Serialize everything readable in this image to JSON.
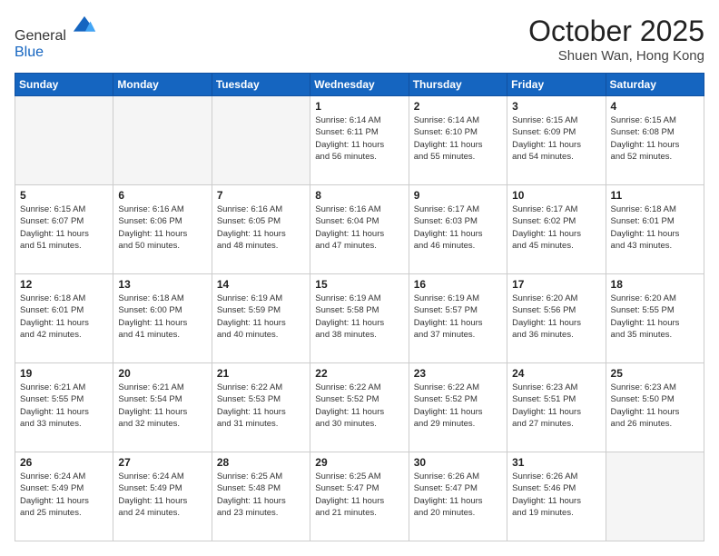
{
  "header": {
    "logo_general": "General",
    "logo_blue": "Blue",
    "month_title": "October 2025",
    "location": "Shuen Wan, Hong Kong"
  },
  "days_of_week": [
    "Sunday",
    "Monday",
    "Tuesday",
    "Wednesday",
    "Thursday",
    "Friday",
    "Saturday"
  ],
  "weeks": [
    [
      {
        "day": "",
        "info": ""
      },
      {
        "day": "",
        "info": ""
      },
      {
        "day": "",
        "info": ""
      },
      {
        "day": "1",
        "info": "Sunrise: 6:14 AM\nSunset: 6:11 PM\nDaylight: 11 hours\nand 56 minutes."
      },
      {
        "day": "2",
        "info": "Sunrise: 6:14 AM\nSunset: 6:10 PM\nDaylight: 11 hours\nand 55 minutes."
      },
      {
        "day": "3",
        "info": "Sunrise: 6:15 AM\nSunset: 6:09 PM\nDaylight: 11 hours\nand 54 minutes."
      },
      {
        "day": "4",
        "info": "Sunrise: 6:15 AM\nSunset: 6:08 PM\nDaylight: 11 hours\nand 52 minutes."
      }
    ],
    [
      {
        "day": "5",
        "info": "Sunrise: 6:15 AM\nSunset: 6:07 PM\nDaylight: 11 hours\nand 51 minutes."
      },
      {
        "day": "6",
        "info": "Sunrise: 6:16 AM\nSunset: 6:06 PM\nDaylight: 11 hours\nand 50 minutes."
      },
      {
        "day": "7",
        "info": "Sunrise: 6:16 AM\nSunset: 6:05 PM\nDaylight: 11 hours\nand 48 minutes."
      },
      {
        "day": "8",
        "info": "Sunrise: 6:16 AM\nSunset: 6:04 PM\nDaylight: 11 hours\nand 47 minutes."
      },
      {
        "day": "9",
        "info": "Sunrise: 6:17 AM\nSunset: 6:03 PM\nDaylight: 11 hours\nand 46 minutes."
      },
      {
        "day": "10",
        "info": "Sunrise: 6:17 AM\nSunset: 6:02 PM\nDaylight: 11 hours\nand 45 minutes."
      },
      {
        "day": "11",
        "info": "Sunrise: 6:18 AM\nSunset: 6:01 PM\nDaylight: 11 hours\nand 43 minutes."
      }
    ],
    [
      {
        "day": "12",
        "info": "Sunrise: 6:18 AM\nSunset: 6:01 PM\nDaylight: 11 hours\nand 42 minutes."
      },
      {
        "day": "13",
        "info": "Sunrise: 6:18 AM\nSunset: 6:00 PM\nDaylight: 11 hours\nand 41 minutes."
      },
      {
        "day": "14",
        "info": "Sunrise: 6:19 AM\nSunset: 5:59 PM\nDaylight: 11 hours\nand 40 minutes."
      },
      {
        "day": "15",
        "info": "Sunrise: 6:19 AM\nSunset: 5:58 PM\nDaylight: 11 hours\nand 38 minutes."
      },
      {
        "day": "16",
        "info": "Sunrise: 6:19 AM\nSunset: 5:57 PM\nDaylight: 11 hours\nand 37 minutes."
      },
      {
        "day": "17",
        "info": "Sunrise: 6:20 AM\nSunset: 5:56 PM\nDaylight: 11 hours\nand 36 minutes."
      },
      {
        "day": "18",
        "info": "Sunrise: 6:20 AM\nSunset: 5:55 PM\nDaylight: 11 hours\nand 35 minutes."
      }
    ],
    [
      {
        "day": "19",
        "info": "Sunrise: 6:21 AM\nSunset: 5:55 PM\nDaylight: 11 hours\nand 33 minutes."
      },
      {
        "day": "20",
        "info": "Sunrise: 6:21 AM\nSunset: 5:54 PM\nDaylight: 11 hours\nand 32 minutes."
      },
      {
        "day": "21",
        "info": "Sunrise: 6:22 AM\nSunset: 5:53 PM\nDaylight: 11 hours\nand 31 minutes."
      },
      {
        "day": "22",
        "info": "Sunrise: 6:22 AM\nSunset: 5:52 PM\nDaylight: 11 hours\nand 30 minutes."
      },
      {
        "day": "23",
        "info": "Sunrise: 6:22 AM\nSunset: 5:52 PM\nDaylight: 11 hours\nand 29 minutes."
      },
      {
        "day": "24",
        "info": "Sunrise: 6:23 AM\nSunset: 5:51 PM\nDaylight: 11 hours\nand 27 minutes."
      },
      {
        "day": "25",
        "info": "Sunrise: 6:23 AM\nSunset: 5:50 PM\nDaylight: 11 hours\nand 26 minutes."
      }
    ],
    [
      {
        "day": "26",
        "info": "Sunrise: 6:24 AM\nSunset: 5:49 PM\nDaylight: 11 hours\nand 25 minutes."
      },
      {
        "day": "27",
        "info": "Sunrise: 6:24 AM\nSunset: 5:49 PM\nDaylight: 11 hours\nand 24 minutes."
      },
      {
        "day": "28",
        "info": "Sunrise: 6:25 AM\nSunset: 5:48 PM\nDaylight: 11 hours\nand 23 minutes."
      },
      {
        "day": "29",
        "info": "Sunrise: 6:25 AM\nSunset: 5:47 PM\nDaylight: 11 hours\nand 21 minutes."
      },
      {
        "day": "30",
        "info": "Sunrise: 6:26 AM\nSunset: 5:47 PM\nDaylight: 11 hours\nand 20 minutes."
      },
      {
        "day": "31",
        "info": "Sunrise: 6:26 AM\nSunset: 5:46 PM\nDaylight: 11 hours\nand 19 minutes."
      },
      {
        "day": "",
        "info": ""
      }
    ]
  ]
}
